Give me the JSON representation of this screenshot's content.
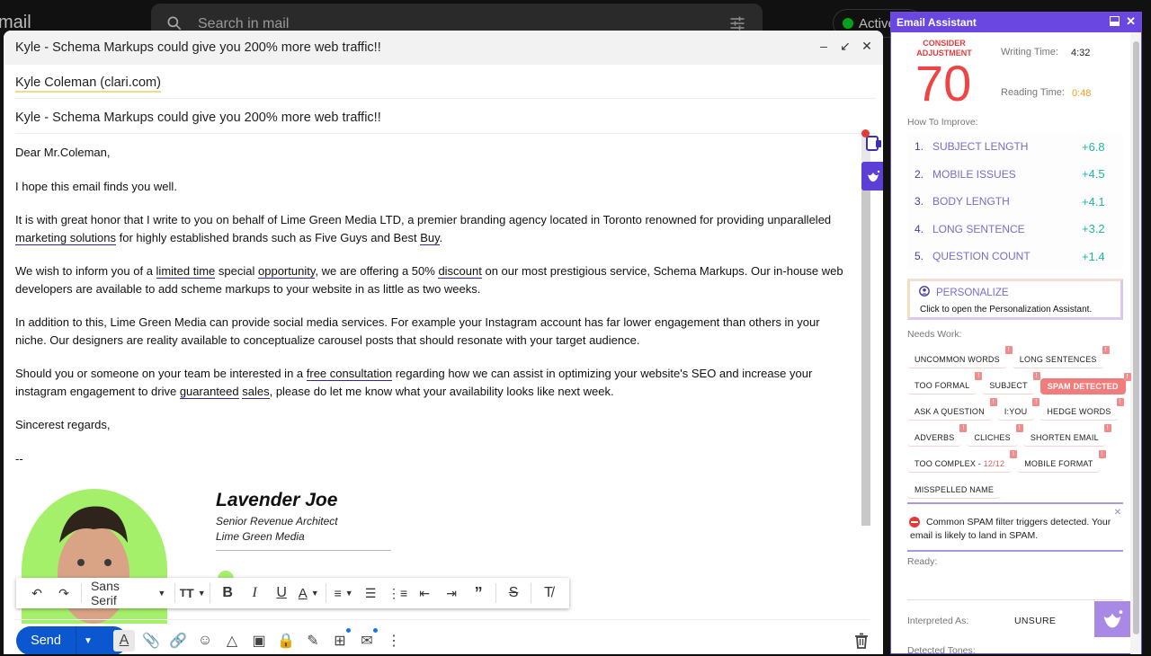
{
  "gmail": {
    "logo_text": "mail",
    "search_placeholder": "Search in mail",
    "status": "Active"
  },
  "compose": {
    "window_title": "Kyle - Schema Markups could give you 200% more web traffic!!",
    "to": "Kyle Coleman (clari.com)",
    "subject": "Kyle - Schema Markups could give you 200% more web traffic!!",
    "body": {
      "greeting": "Dear Mr.Coleman,",
      "p1": "I hope this email finds you well.",
      "p2": [
        {
          "t": "It is with great honor that I write to you on behalf of Lime Green Media LTD, a premier branding agency located in Toronto renowned for providing unparalleled ",
          "u": false
        },
        {
          "t": "marketing solutions",
          "u": true
        },
        {
          "t": " for highly established brands such as Five Guys and Best ",
          "u": false
        },
        {
          "t": "Buy",
          "u": true
        },
        {
          "t": ".",
          "u": false
        }
      ],
      "p3": [
        {
          "t": "We wish to inform you of a ",
          "u": false
        },
        {
          "t": "limited time",
          "u": true
        },
        {
          "t": " special ",
          "u": false
        },
        {
          "t": "opportunity",
          "u": true
        },
        {
          "t": ", we are offering a 50% ",
          "u": false
        },
        {
          "t": "discount",
          "u": true
        },
        {
          "t": " on our most prestigious service, Schema Markups. Our in-house web developers are available to add scheme markups to your website in as little as two weeks.",
          "u": false
        }
      ],
      "p4": "In addition to this, Lime Green Media can provide social media services. For example your Instagram account has far lower engagement than others in your niche. Our designers are reality available to conceptualize carousel posts that should resonate with your target audience.",
      "p5": [
        {
          "t": "Should you or someone on your team be interested in a ",
          "u": false
        },
        {
          "t": "free consultation",
          "u": true
        },
        {
          "t": " regarding how we can assist in optimizing your website's SEO and increase your instagram engagement to drive ",
          "u": false
        },
        {
          "t": "guaranteed",
          "u": true
        },
        {
          "t": " ",
          "u": false
        },
        {
          "t": "sales",
          "u": true
        },
        {
          "t": ", please do let me know what your availability looks like next week.",
          "u": false
        }
      ],
      "closing": "Sincerest regards,",
      "sig_sep": "--"
    },
    "signature": {
      "name": "Lavender Joe",
      "title": "Senior Revenue Architect",
      "company": "Lime Green Media"
    },
    "toolbar": {
      "font": "Sans Serif"
    },
    "send_label": "Send"
  },
  "assistant": {
    "title": "Email Assistant",
    "score_label": "CONSIDER ADJUSTMENT",
    "score": "70",
    "writing_time_label": "Writing Time:",
    "writing_time": "4:32",
    "reading_time_label": "Reading Time:",
    "reading_time": "0:48",
    "how_to_improve_label": "How To Improve:",
    "improvements": [
      {
        "num": "1.",
        "name": "SUBJECT LENGTH",
        "value": "+6.8"
      },
      {
        "num": "2.",
        "name": "MOBILE ISSUES",
        "value": "+4.5"
      },
      {
        "num": "3.",
        "name": "BODY LENGTH",
        "value": "+4.1"
      },
      {
        "num": "4.",
        "name": "LONG SENTENCE",
        "value": "+3.2"
      },
      {
        "num": "5.",
        "name": "QUESTION COUNT",
        "value": "+1.4"
      }
    ],
    "personalize": {
      "title": "PERSONALIZE",
      "desc": "Click to open the Personalization Assistant."
    },
    "needs_work_label": "Needs Work:",
    "needs_work": [
      [
        "UNCOMMON WORDS",
        "LONG SENTENCES"
      ],
      [
        "TOO FORMAL",
        "SUBJECT",
        "SPAM DETECTED"
      ],
      [
        "ASK A QUESTION",
        "I:YOU",
        "HEDGE WORDS"
      ],
      [
        "ADVERBS",
        "CLICHES",
        "SHORTEN EMAIL"
      ],
      [
        "TOO COMPLEX - ",
        "MOBILE FORMAT"
      ],
      [
        "MISSPELLED NAME"
      ]
    ],
    "too_complex_count": "12/12",
    "spam_alert": "Common SPAM filter triggers detected. Your email is likely to land in SPAM.",
    "ready_label": "Ready:",
    "interpreted_label": "Interpreted As:",
    "interpreted_value": "UNSURE",
    "tones_label": "Detected Tones:",
    "colors": {
      "brand": "#6a47e0",
      "score": "#ee4444",
      "positive": "#1fb5a3",
      "reading_time": "#f29b1f",
      "spam": "#f27c7c"
    }
  }
}
